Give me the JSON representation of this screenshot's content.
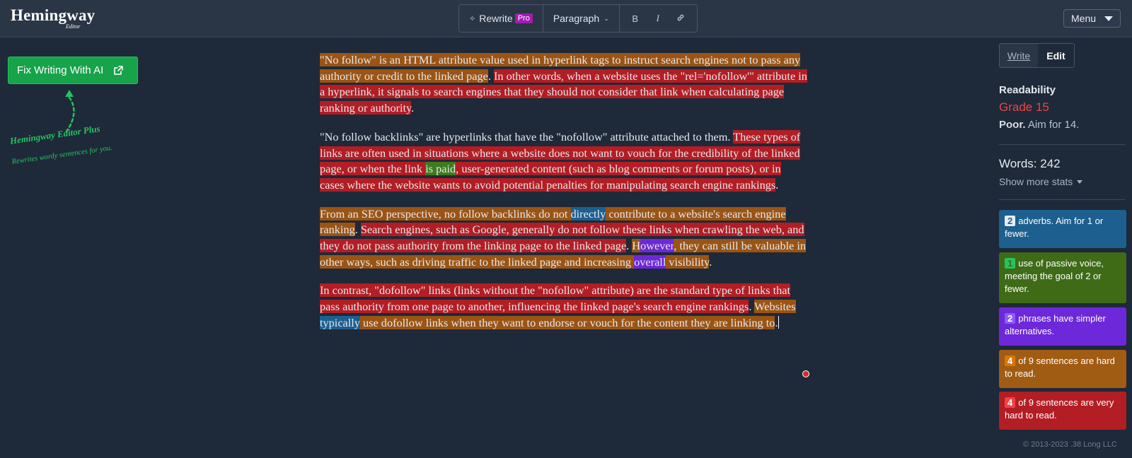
{
  "app": {
    "logo_main": "Hemingway",
    "logo_sub": "Editor"
  },
  "toolbar": {
    "rewrite_label": "Rewrite",
    "pro_badge": "Pro",
    "paragraph_label": "Paragraph",
    "bold_icon": "B",
    "italic_icon": "I",
    "link_icon": "link-icon"
  },
  "menu": {
    "label": "Menu"
  },
  "fix_button": {
    "label": "Fix Writing With AI",
    "icon": "external-link-icon"
  },
  "promo": {
    "title": "Hemingway Editor Plus",
    "subtitle": "Rewrites wordy sentences for you."
  },
  "mode": {
    "write": "Write",
    "edit": "Edit"
  },
  "readability": {
    "heading": "Readability",
    "grade": "Grade 15",
    "verdict": "Poor.",
    "aim": "Aim for 14."
  },
  "stats": {
    "words": "Words: 242",
    "show_more": "Show more stats"
  },
  "cards": {
    "adverbs": {
      "count": "2",
      "text": "adverbs. Aim for 1 or fewer."
    },
    "passive": {
      "count": "1",
      "text": "use of passive voice, meeting the goal of 2 or fewer."
    },
    "simpler": {
      "count": "2",
      "text": "phrases have simpler alternatives."
    },
    "hard": {
      "count": "4",
      "text": "of 9 sentences are hard to read."
    },
    "very_hard": {
      "count": "4",
      "text": "of 9 sentences are very hard to read."
    }
  },
  "footer": "© 2013-2023 .38 Long LLC",
  "colors": {
    "hard": "#9a5414",
    "very_hard": "#b31d24",
    "adverb": "#1d5f8f",
    "passive": "#3f7a1c",
    "simpler": "#6d28d9",
    "accent_green": "#16a34a",
    "grade_red": "#ef4444"
  },
  "editor": {
    "p1": [
      {
        "t": "\"No follow\" is an HTML attribute value used in hyperlink tags to instruct search engines not to pass any authority or credit to the linked page",
        "c": "hard"
      },
      {
        "t": ". ",
        "c": ""
      },
      {
        "t": "In other words, when a website uses the \"rel='nofollow'\" attribute in a hyperlink, it signals to search engines that they should not consider that link when calculating page ranking or authority",
        "c": "vhard"
      },
      {
        "t": ".",
        "c": ""
      }
    ],
    "p2": [
      {
        "t": "\"No follow backlinks\" are hyperlinks that have the \"nofollow\" attribute attached to them. ",
        "c": ""
      },
      {
        "t": "These types of links are often used in situations where a website does not want to vouch for the credibility of the linked page, or when the link ",
        "c": "vhard"
      },
      {
        "t": "is paid",
        "c": "passive"
      },
      {
        "t": ", user-generated content (such as blog comments or forum posts), or in cases where the website wants to avoid potential penalties for manipulating search engine rankings",
        "c": "vhard"
      },
      {
        "t": ".",
        "c": ""
      }
    ],
    "p3": [
      {
        "t": "From an SEO perspective, no follow backlinks do not ",
        "c": "hard"
      },
      {
        "t": "directly",
        "c": "adverb"
      },
      {
        "t": " contribute to a website's search engine ranking",
        "c": "hard"
      },
      {
        "t": ". ",
        "c": ""
      },
      {
        "t": "Search engines, such as Google, generally do not follow these links when crawling the web, and they do not pass authority from the linking page to the linked page",
        "c": "vhard"
      },
      {
        "t": ". ",
        "c": ""
      },
      {
        "t": "H",
        "c": "hard"
      },
      {
        "t": "owever",
        "c": "simpler"
      },
      {
        "t": ", they can still be valuable in other ways, such as driving traffic to the linked page and increasing ",
        "c": "hard"
      },
      {
        "t": "overall",
        "c": "simpler"
      },
      {
        "t": " visibility",
        "c": "hard"
      },
      {
        "t": ".",
        "c": ""
      }
    ],
    "p4": [
      {
        "t": "In contrast, \"dofollow\" links (links without the \"nofollow\" attribute) are the standard type of links that pass authority from one page to another, influencing the linked page's search engine rankings",
        "c": "vhard"
      },
      {
        "t": ". ",
        "c": ""
      },
      {
        "t": "Websites ",
        "c": "hard"
      },
      {
        "t": "typically",
        "c": "adverb"
      },
      {
        "t": " use dofollow links when they want to endorse or vouch for the content they are linking to",
        "c": "hard"
      },
      {
        "t": ".",
        "c": ""
      }
    ]
  }
}
